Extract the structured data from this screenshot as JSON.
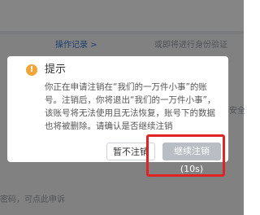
{
  "background": {
    "operation_record_link": "操作记录 >",
    "identity_verify_text": "或即将进行身份验证",
    "right_edge_text": "安全",
    "bottom_text": "密码，可点此申诉"
  },
  "dialog": {
    "icon": "warning-icon",
    "title": "提示",
    "message": "你正在申请注销在“我们的一万件小事”的账号。注销后，你将退出“我们的一万件小事”，该账号将无法使用且无法恢复，账号下的数据也将被删除。请确认是否继续注销",
    "cancel_label": "暂不注销",
    "confirm_label": "继续注销(10s)"
  },
  "colors": {
    "warning": "#f0a63a",
    "confirm_disabled": "#b9bec5",
    "highlight": "#e02424",
    "link": "#3a7bd5"
  }
}
